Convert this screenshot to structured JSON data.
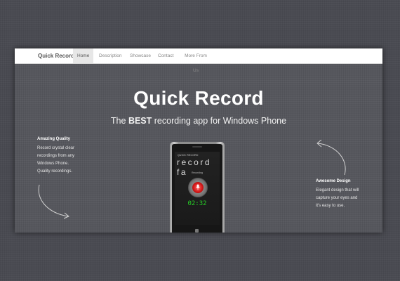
{
  "navbar": {
    "brand": "Quick Record",
    "items": [
      {
        "label": "Home",
        "active": true
      },
      {
        "label": "Description",
        "active": false
      },
      {
        "label": "Showcase",
        "active": false
      },
      {
        "label": "Contact",
        "active": false
      },
      {
        "label": "More From Us",
        "active": false
      }
    ]
  },
  "hero": {
    "title": "Quick Record",
    "tagline_pre": "The ",
    "tagline_bold": "BEST",
    "tagline_post": " recording app for Windows Phone"
  },
  "features": {
    "left": {
      "title": "Amazing Quality",
      "lines": [
        "Record crystal clear",
        "recordings from any",
        "Windows Phone.",
        "Quality recordings."
      ]
    },
    "right": {
      "title": "Awesome Design",
      "lines": [
        "Elegant design that will",
        "capture your eyes and",
        "it's easy to use."
      ]
    }
  },
  "phone": {
    "app_label": "QUICK RECORD",
    "app_title": "record fa",
    "status": "Recording",
    "timer": "02:32"
  },
  "colors": {
    "page_bg": "#4a4b52",
    "frame_bg": "#56575d",
    "accent_record": "#d41818",
    "timer_green": "#27d127"
  },
  "icons": [
    "mic-icon",
    "curved-arrow-icon",
    "windows-icon"
  ]
}
